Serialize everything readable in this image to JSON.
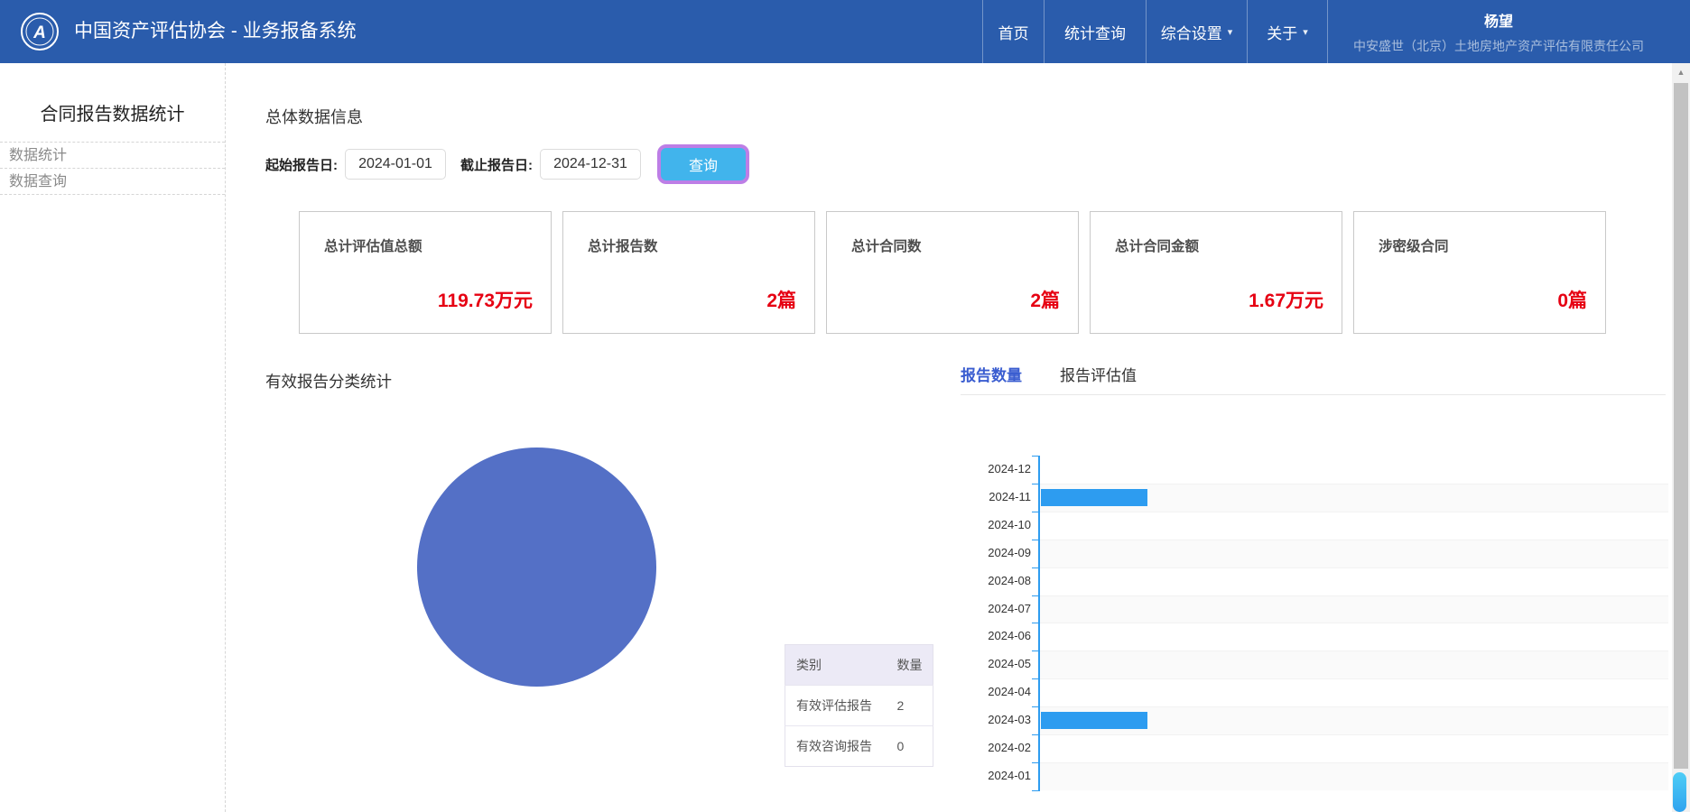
{
  "navbar": {
    "brand": "中国资产评估协会 - 业务报备系统",
    "items": [
      {
        "label": "首页"
      },
      {
        "label": "统计查询"
      },
      {
        "label": "综合设置",
        "dropdown": true
      },
      {
        "label": "关于",
        "dropdown": true
      }
    ],
    "user": {
      "name": "杨望",
      "company": "中安盛世（北京）土地房地产资产评估有限责任公司"
    }
  },
  "sidebar": {
    "title": "合同报告数据统计",
    "items": [
      {
        "label": "数据统计"
      },
      {
        "label": "数据查询"
      }
    ]
  },
  "main": {
    "section_title": "总体数据信息",
    "filters": {
      "start_label": "起始报告日:",
      "start_value": "2024-01-01",
      "end_label": "截止报告日:",
      "end_value": "2024-12-31",
      "search_label": "查询"
    },
    "stat_cards": [
      {
        "title": "总计评估值总额",
        "value": "119.73万元"
      },
      {
        "title": "总计报告数",
        "value": "2篇"
      },
      {
        "title": "总计合同数",
        "value": "2篇"
      },
      {
        "title": "总计合同金额",
        "value": "1.67万元"
      },
      {
        "title": "涉密级合同",
        "value": "0篇"
      }
    ],
    "pie_section": {
      "title": "有效报告分类统计"
    },
    "tabs": [
      {
        "label": "报告数量",
        "active": true
      },
      {
        "label": "报告评估值",
        "active": false
      }
    ],
    "category_table": {
      "headers": [
        "类别",
        "数量"
      ],
      "rows": [
        [
          "有效评估报告",
          "2"
        ],
        [
          "有效咨询报告",
          "0"
        ]
      ]
    }
  },
  "chart_data": [
    {
      "type": "pie",
      "title": "有效报告分类统计",
      "labels": [
        "有效评估报告",
        "有效咨询报告"
      ],
      "values": [
        2,
        0
      ],
      "colors": [
        "#5470c6"
      ],
      "note": "single full slice (100% 有效评估报告)"
    },
    {
      "type": "bar",
      "orientation": "horizontal",
      "title": "报告数量",
      "categories": [
        "2024-12",
        "2024-11",
        "2024-10",
        "2024-09",
        "2024-08",
        "2024-07",
        "2024-06",
        "2024-05",
        "2024-04",
        "2024-03",
        "2024-02",
        "2024-01"
      ],
      "values": [
        0,
        1,
        0,
        0,
        0,
        0,
        0,
        0,
        0,
        1,
        0,
        0
      ],
      "bar_color": "#2d9cf0",
      "axis_color": "#2d9cf0",
      "xlabel": "",
      "ylabel": "",
      "grid": true,
      "legend_position": "none"
    }
  ],
  "colors": {
    "navbar_bg": "#2a5cac",
    "tab_active_blue": "#3a5dd0",
    "bar_blue": "#2d9cf0",
    "pie_blue": "#5470c6",
    "value_red": "#e60012",
    "button_blue": "#41b4ec",
    "button_ring": "#bd7ee6",
    "table_header_bg": "#eceaf6"
  }
}
